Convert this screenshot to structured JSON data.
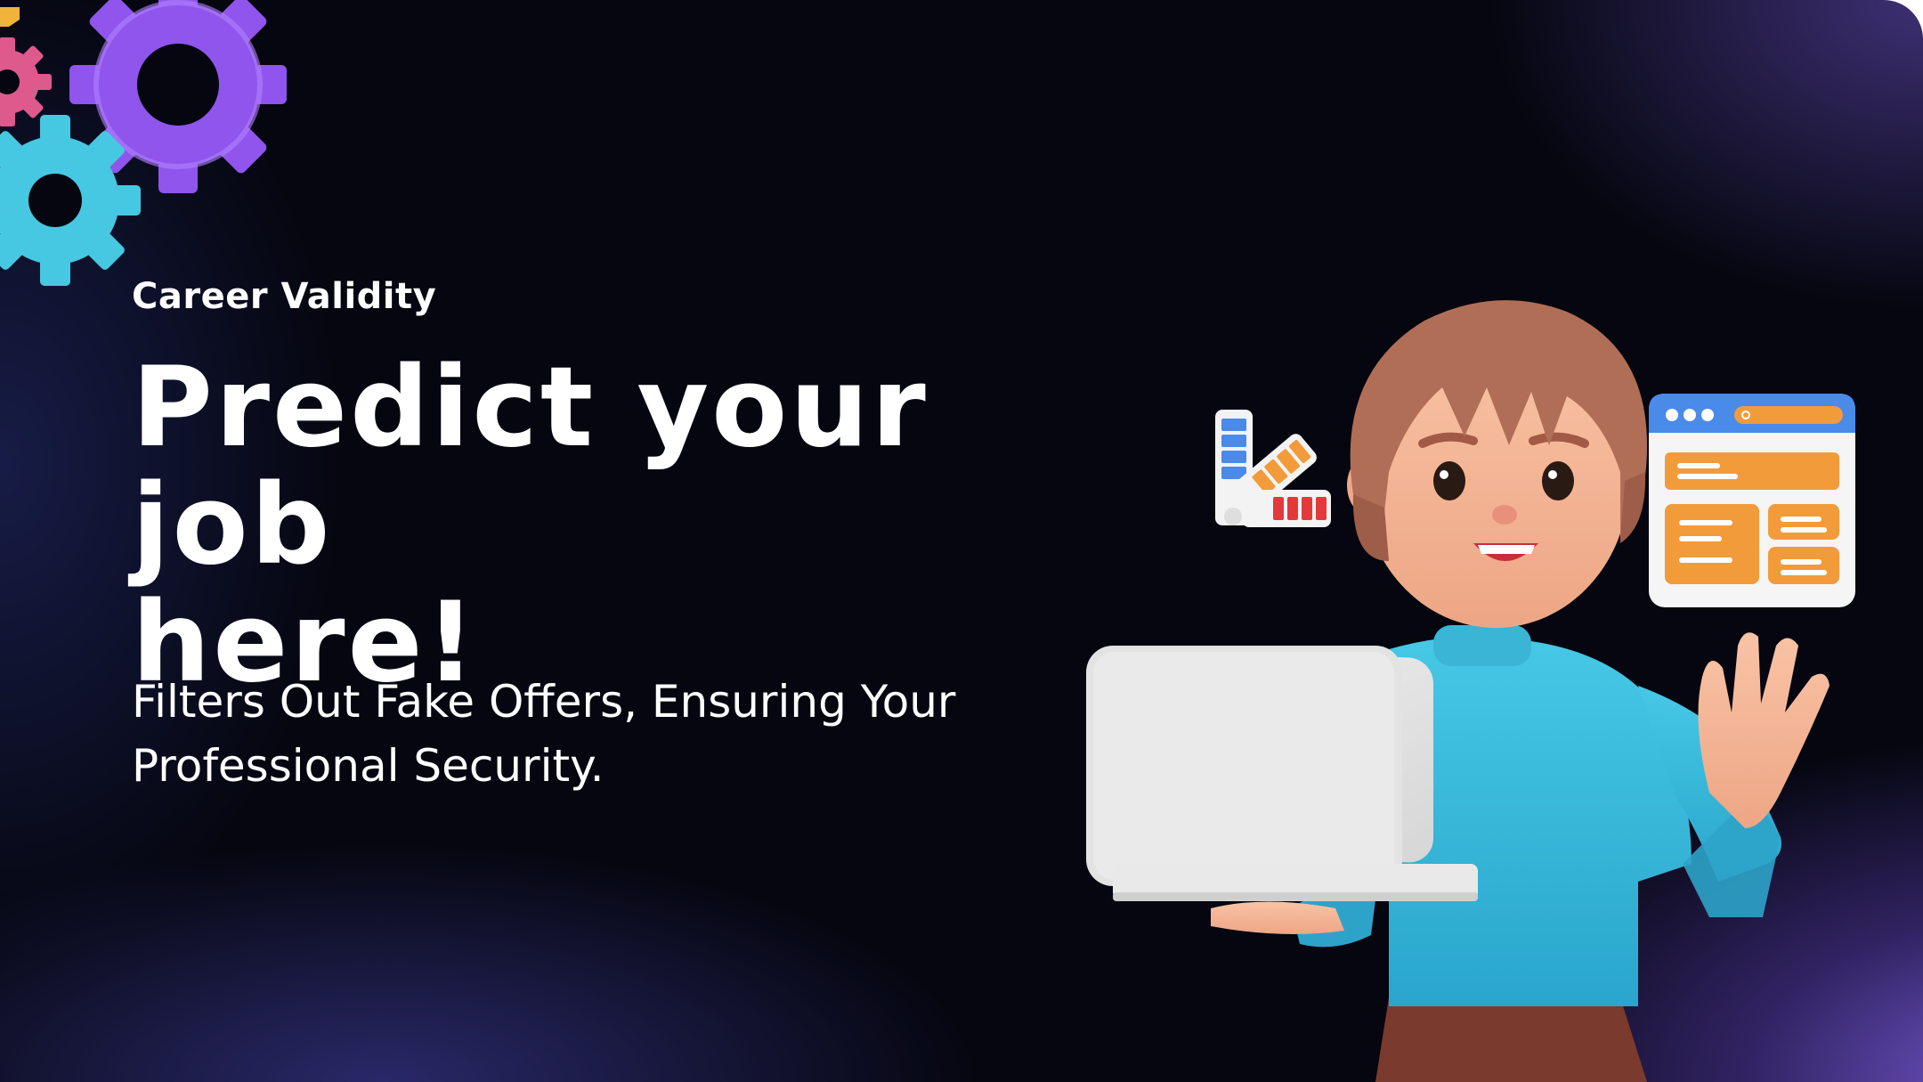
{
  "brand": {
    "name": "Career Validity"
  },
  "hero": {
    "headline_line1": "Predict your job",
    "headline_line2": "here!",
    "subheadline_line1": "Filters Out Fake Offers, Ensuring Your",
    "subheadline_line2": "Professional Security."
  },
  "colors": {
    "background": "#05060f",
    "accent_purple": "#7a5cd6",
    "gear_purple": "#9b62f0",
    "gear_cyan": "#4fd0e8",
    "gear_pink": "#e0568a",
    "shirt": "#3ab8d8",
    "hair": "#b5735a",
    "ui_card_orange": "#f29b3a",
    "ui_card_blue": "#4a8ae8"
  },
  "icons": [
    "gear-icon",
    "color-swatch-icon",
    "browser-window-icon",
    "laptop-icon"
  ]
}
